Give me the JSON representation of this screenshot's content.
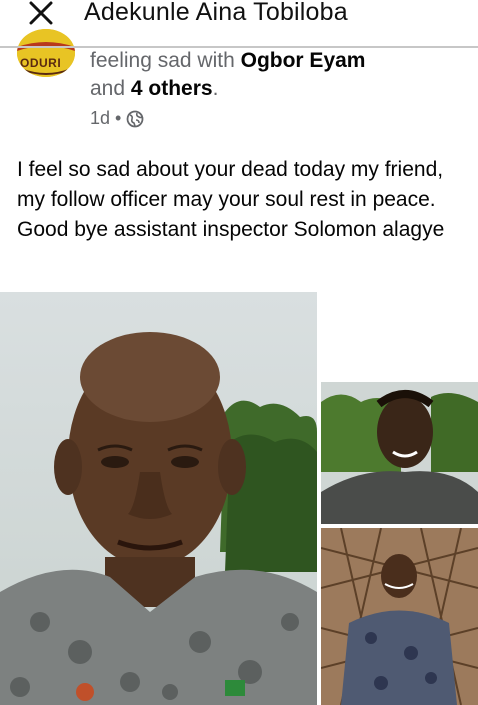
{
  "header": {
    "title": "Adekunle Aina Tobiloba",
    "close_icon": "close-icon"
  },
  "post": {
    "avatar_text": "ODURI",
    "feeling_prefix": "feeling sad with",
    "tagged_person": "Ogbor Eyam",
    "and_word": "and",
    "others": "4 others",
    "period": ".",
    "time": "1d",
    "separator": "•",
    "privacy_icon": "globe-icon",
    "text": "I feel so sad about your dead today my friend, my follow officer may your soul rest in peace. Good bye assistant inspector Solomon alagye"
  },
  "photos": {
    "count": 3
  }
}
